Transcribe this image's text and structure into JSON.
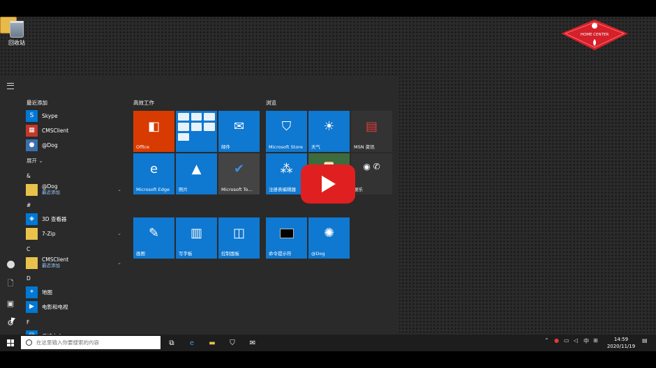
{
  "desktop": {
    "recycle_bin_label": "回收站"
  },
  "logo": {
    "text": "HOME CENTER",
    "color": "#d4202a"
  },
  "start_menu": {
    "recent_header": "最近添加",
    "recent_apps": [
      "Skype",
      "CMSClient",
      "@Dog"
    ],
    "expand_label": "展开",
    "letters": [
      "&",
      "#",
      "C",
      "D",
      "F"
    ],
    "apps": [
      {
        "name": "@Dog",
        "sub": "最近添加"
      },
      {
        "name": "3D 查看器"
      },
      {
        "name": "7-Zip"
      },
      {
        "name": "CMSClient",
        "sub": "最近添加"
      },
      {
        "name": "地图"
      },
      {
        "name": "电影和电视"
      },
      {
        "name": "反馈中心"
      }
    ],
    "groups": [
      "高效工作",
      "浏览"
    ],
    "tiles": {
      "office": "Office",
      "mail": "邮件",
      "edge": "Microsoft Edge",
      "photos": "照片",
      "todo": "Microsoft To...",
      "store": "Microsoft Store",
      "weather": "天气",
      "msn": "MSN 资讯",
      "notes": "注册表编辑器",
      "play": "娱乐",
      "paint": "画图",
      "wordpad": "写字板",
      "control": "控制面板",
      "cmd": "命令提示符",
      "dog": "@Dog"
    }
  },
  "taskbar": {
    "search_placeholder": "在这里输入你要搜索的内容",
    "ime": "中",
    "time": "14:59",
    "date": "2020/11/19"
  },
  "colors": {
    "tile_blue": "#0f78d0",
    "office_orange": "#d83b01",
    "play_red": "#e02020"
  }
}
